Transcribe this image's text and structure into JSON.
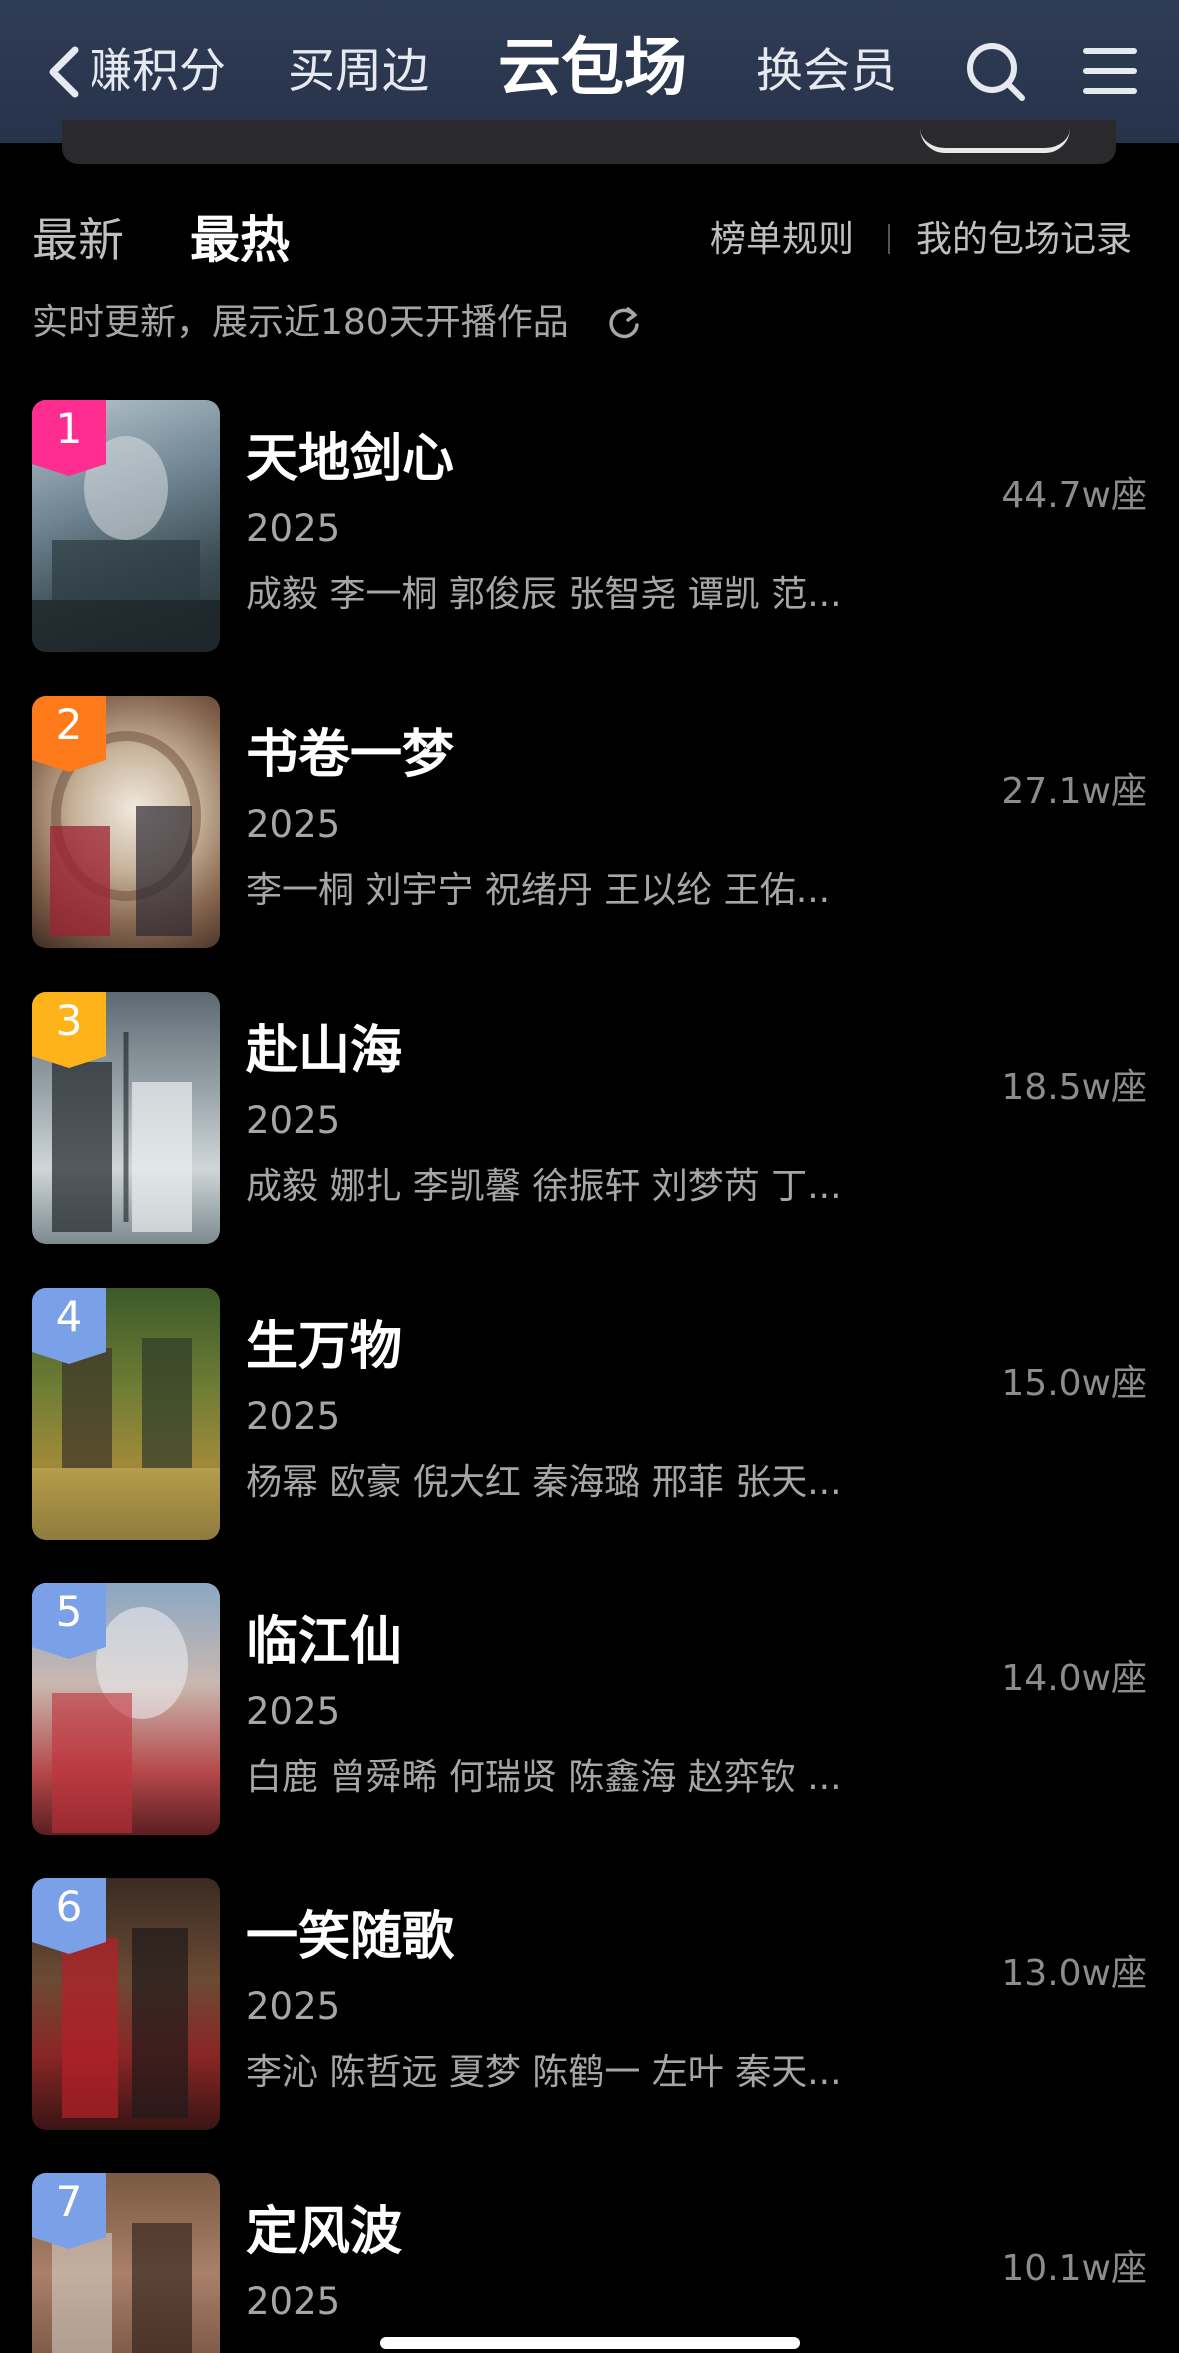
{
  "nav": {
    "tabs": [
      "赚积分",
      "买周边",
      "云包场",
      "换会员"
    ],
    "active_tab": "云包场"
  },
  "filter": {
    "tabs": [
      "最新",
      "最热"
    ],
    "active": "最热",
    "rules_link": "榜单规则",
    "records_link": "我的包场记录"
  },
  "note": "实时更新，展示近180天开播作品",
  "items": [
    {
      "rank": "1",
      "title": "天地剑心",
      "year": "2025",
      "cast": "成毅 李一桐 郭俊辰 张智尧 谭凯 范...",
      "seats": "44.7w座",
      "badge_color": "#ff2d8f"
    },
    {
      "rank": "2",
      "title": "书卷一梦",
      "year": "2025",
      "cast": "李一桐 刘宇宁 祝绪丹 王以纶 王佑...",
      "seats": "27.1w座",
      "badge_color": "#ff7a1a"
    },
    {
      "rank": "3",
      "title": "赴山海",
      "year": "2025",
      "cast": "成毅 娜扎 李凯馨 徐振轩 刘梦芮 丁...",
      "seats": "18.5w座",
      "badge_color": "#ffb31a"
    },
    {
      "rank": "4",
      "title": "生万物",
      "year": "2025",
      "cast": "杨幂 欧豪 倪大红 秦海璐 邢菲 张天...",
      "seats": "15.0w座",
      "badge_color": "#7aa0e8"
    },
    {
      "rank": "5",
      "title": "临江仙",
      "year": "2025",
      "cast": "白鹿 曾舜晞 何瑞贤 陈鑫海 赵弈钦 ...",
      "seats": "14.0w座",
      "badge_color": "#7aa0e8"
    },
    {
      "rank": "6",
      "title": "一笑随歌",
      "year": "2025",
      "cast": "李沁 陈哲远 夏梦 陈鹤一 左叶 秦天...",
      "seats": "13.0w座",
      "badge_color": "#7aa0e8"
    },
    {
      "rank": "7",
      "title": "定风波",
      "year": "2025",
      "cast": "",
      "seats": "10.1w座",
      "badge_color": "#7aa0e8"
    }
  ]
}
